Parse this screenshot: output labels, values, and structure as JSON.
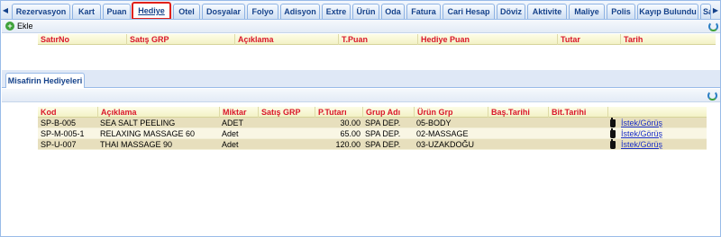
{
  "tabs": [
    {
      "label": "Rezervasyon"
    },
    {
      "label": "Kart"
    },
    {
      "label": "Puan"
    },
    {
      "label": "Hediye"
    },
    {
      "label": "Otel"
    },
    {
      "label": "Dosyalar"
    },
    {
      "label": "Folyo"
    },
    {
      "label": "Adisyon"
    },
    {
      "label": "Extre"
    },
    {
      "label": "Ürün"
    },
    {
      "label": "Oda"
    },
    {
      "label": "Fatura"
    },
    {
      "label": "Cari Hesap"
    },
    {
      "label": "Döviz"
    },
    {
      "label": "Aktivite"
    },
    {
      "label": "Maliye"
    },
    {
      "label": "Polis"
    },
    {
      "label": "Kayıp Bulundu"
    },
    {
      "label": "Sa"
    }
  ],
  "active_tab": "Hediye",
  "toolbar": {
    "add_label": "Ekle"
  },
  "gift_grid": {
    "columns": [
      "SatırNo",
      "Satış GRP",
      "Açıklama",
      "T.Puan",
      "Hediye Puan",
      "Tutar",
      "Tarih"
    ]
  },
  "guest_panel": {
    "tab_label": "Misafirin Hediyeleri",
    "columns": [
      "Kod",
      "Açıklama",
      "Miktar",
      "Satış GRP",
      "P.Tutarı",
      "Grup Adı",
      "Ürün Grp",
      "Baş.Tarihi",
      "Bit.Tarihi",
      ""
    ],
    "rows": [
      {
        "kod": "SP-B-005",
        "aciklama": "SEA SALT PEELING",
        "miktar": "ADET",
        "satis_grp": "",
        "tutar": "30.00",
        "grup_adi": "SPA DEP.",
        "urun_grp": "05-BODY",
        "bas": "",
        "bit": "",
        "link": "İstek/Görüş"
      },
      {
        "kod": "SP-M-005-1",
        "aciklama": "RELAXING MASSAGE 60",
        "miktar": "Adet",
        "satis_grp": "",
        "tutar": "65.00",
        "grup_adi": "SPA DEP.",
        "urun_grp": "02-MASSAGE",
        "bas": "",
        "bit": "",
        "link": "İstek/Görüş"
      },
      {
        "kod": "SP-U-007",
        "aciklama": "THAI MASSAGE 90",
        "miktar": "Adet",
        "satis_grp": "",
        "tutar": "120.00",
        "grup_adi": "SPA DEP.",
        "urun_grp": "03-UZAKDOĞU",
        "bas": "",
        "bit": "",
        "link": "İstek/Görüş"
      }
    ]
  },
  "colors": {
    "accent_red": "#d9172a",
    "tab_text": "#15428b",
    "link": "#1a2ec7"
  }
}
